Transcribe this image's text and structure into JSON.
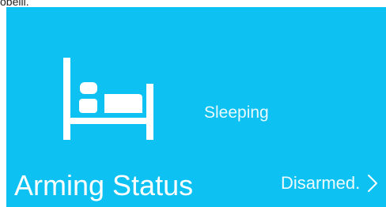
{
  "header_fragment": "obelli.",
  "tile": {
    "background_color": "#0dc2f2",
    "icon": "bed-icon",
    "mode_label": "Sleeping",
    "title": "Arming Status",
    "status_value": "Disarmed.",
    "status_icon": "chevron-right-icon"
  }
}
